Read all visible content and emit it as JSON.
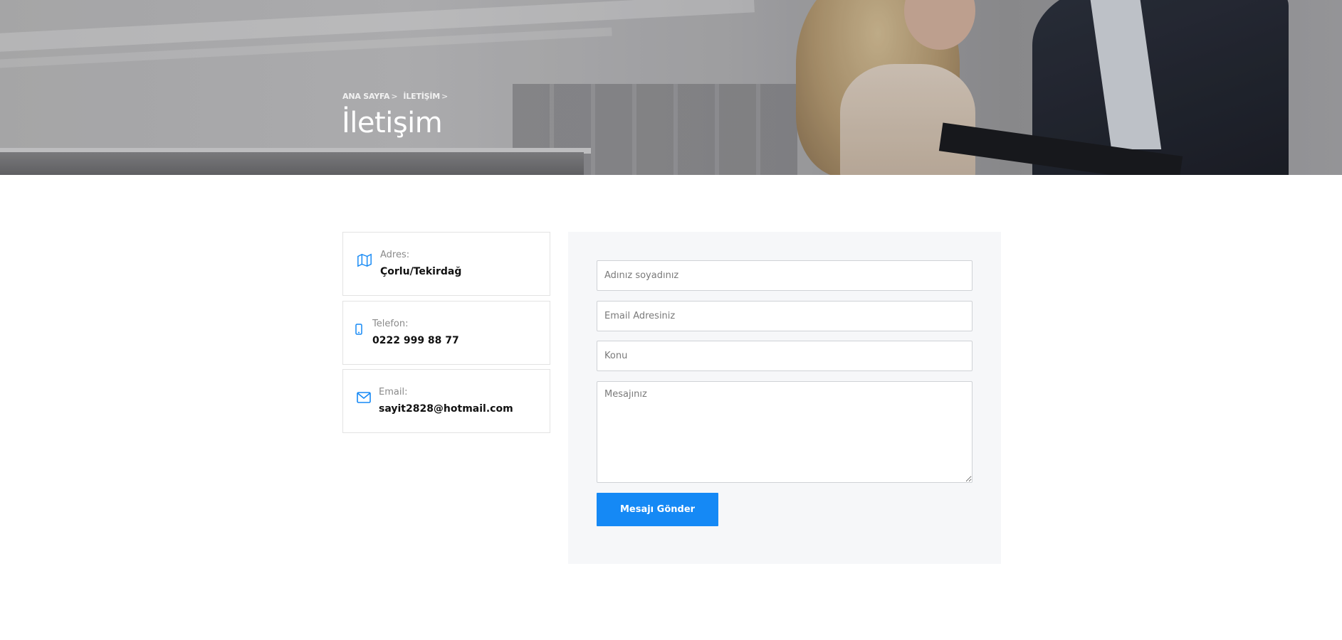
{
  "hero": {
    "breadcrumb": [
      "ANA SAYFA",
      "İLETİŞİM"
    ],
    "breadcrumb_separator": ">",
    "title": "İletişim"
  },
  "contact_info": [
    {
      "icon": "map-icon",
      "label": "Adres:",
      "value": "Çorlu/Tekirdağ"
    },
    {
      "icon": "mobile-phone-icon",
      "label": "Telefon:",
      "value": "0222 999 88 77"
    },
    {
      "icon": "envelope-icon",
      "label": "Email:",
      "value": "sayit2828@hotmail.com"
    }
  ],
  "form": {
    "name_placeholder": "Adınız soyadınız",
    "email_placeholder": "Email Adresiniz",
    "subject_placeholder": "Konu",
    "message_placeholder": "Mesajınız",
    "submit_label": "Mesajı Gönder"
  },
  "colors": {
    "accent": "#1589f5",
    "panel_background": "#f6f7f9",
    "card_border": "#e3e3e3"
  }
}
